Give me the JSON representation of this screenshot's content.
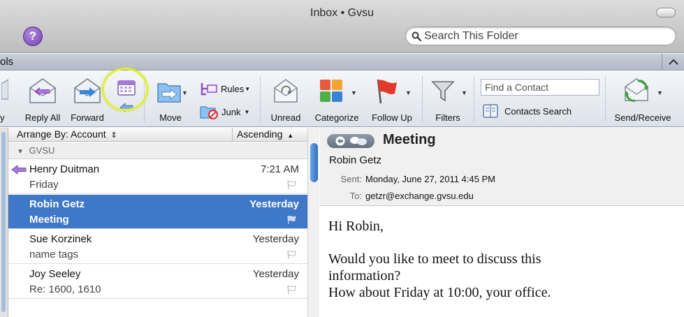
{
  "window": {
    "title": "Inbox • Gvsu"
  },
  "search": {
    "placeholder": "Search This Folder"
  },
  "ribbon": {
    "tab_partial": "ols"
  },
  "toolbar": {
    "reply_partial": "y",
    "reply_all": "Reply All",
    "forward": "Forward",
    "move": "Move",
    "rules": "Rules",
    "junk": "Junk",
    "unread": "Unread",
    "categorize": "Categorize",
    "follow_up": "Follow Up",
    "filters": "Filters",
    "find_contact_placeholder": "Find a Contact",
    "contacts_search": "Contacts Search",
    "send_receive": "Send/Receive"
  },
  "list": {
    "arrange_by": "Arrange By: Account",
    "sort_order": "Ascending",
    "group": "GVSU",
    "messages": [
      {
        "sender": "Henry Duitman",
        "subject": "Friday",
        "time": "7:21 AM",
        "replied": true,
        "selected": false
      },
      {
        "sender": "Robin Getz",
        "subject": "Meeting",
        "time": "Yesterday",
        "replied": false,
        "selected": true
      },
      {
        "sender": "Sue Korzinek",
        "subject": "name tags",
        "time": "Yesterday",
        "replied": false,
        "selected": false
      },
      {
        "sender": "Joy Seeley",
        "subject": "Re: 1600, 1610",
        "time": "Yesterday",
        "replied": false,
        "selected": false
      }
    ]
  },
  "message": {
    "subject": "Meeting",
    "from": "Robin Getz",
    "sent_label": "Sent:",
    "sent_value": "Monday, June 27, 2011 4:45 PM",
    "to_label": "To:",
    "to_value": "getzr@exchange.gvsu.edu",
    "body": [
      "Hi Robin,",
      "Would you like to meet to discuss this",
      "information?",
      "How about Friday at 10:00, your office."
    ]
  },
  "colors": {
    "selection": "#3f77c9",
    "highlight_ring": "#e2ef3c"
  }
}
